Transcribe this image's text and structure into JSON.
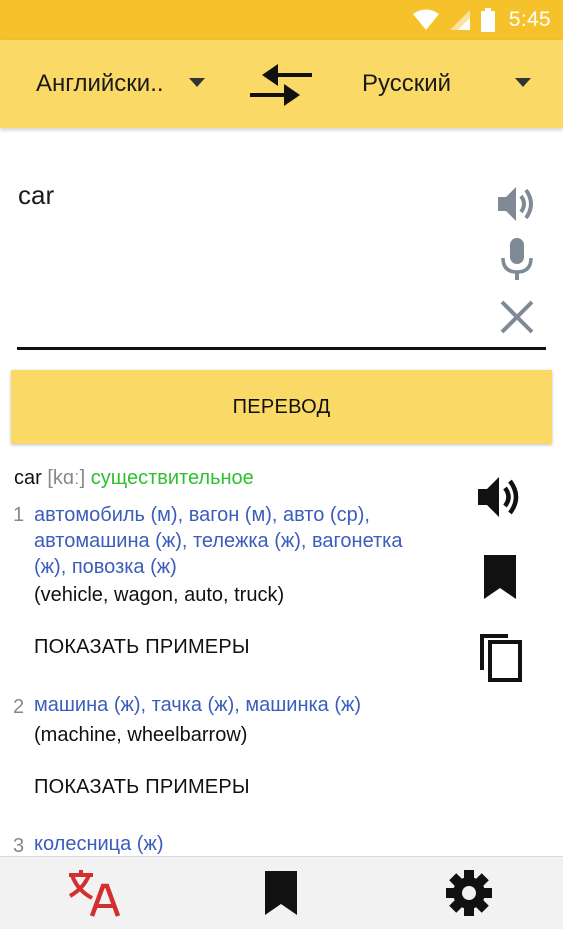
{
  "status_bar": {
    "time": "5:45",
    "icons": [
      "wifi-icon",
      "signal-icon",
      "battery-icon"
    ]
  },
  "language_bar": {
    "source_language": "Английски..",
    "target_language": "Русский",
    "swap_icon": "swap-arrows-icon"
  },
  "input": {
    "text": "car",
    "icons": [
      "speaker-icon",
      "microphone-icon",
      "clear-icon"
    ]
  },
  "translate_button": {
    "label": "ПЕРЕВОД"
  },
  "result": {
    "word": "car",
    "transcription": "[kɑː]",
    "part_of_speech": "существительное",
    "entries": [
      {
        "number": "1",
        "meaning_line1": "автомобиль (м), вагон (м), авто (ср),",
        "meaning_line2": "автомашина (ж), тележка (ж), вагонетка",
        "meaning_line3": "(ж), повозка (ж)",
        "gloss": "(vehicle, wagon, auto, truck)",
        "examples_label": "ПОКАЗАТЬ ПРИМЕРЫ"
      },
      {
        "number": "2",
        "meaning_line1": "машина (ж), тачка (ж), машинка (ж)",
        "gloss": "(machine, wheelbarrow)",
        "examples_label": "ПОКАЗАТЬ ПРИМЕРЫ"
      },
      {
        "number": "3",
        "meaning_line1": "колесница (ж)"
      }
    ],
    "action_icons": [
      "speaker-icon",
      "bookmark-icon",
      "copy-icon"
    ]
  },
  "bottom_nav": {
    "items": [
      "translate-icon",
      "bookmarks-icon",
      "settings-icon"
    ],
    "active_color": "#d32f2f"
  },
  "colors": {
    "status_bar": "#f6c22c",
    "toolbar": "#fbd967",
    "meaning_text": "#3b5dbb",
    "part_of_speech": "#2fbf2f"
  }
}
